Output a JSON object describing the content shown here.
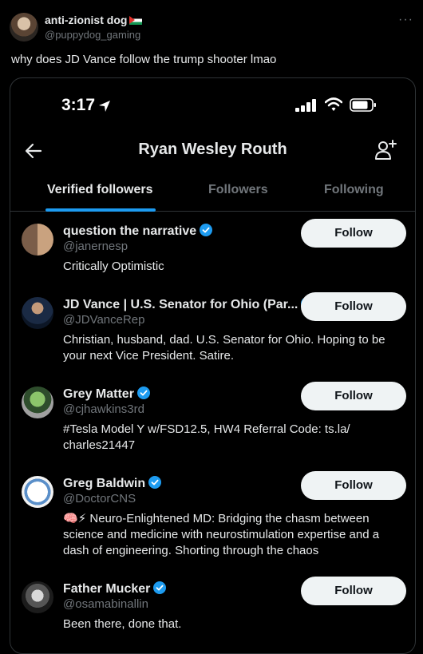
{
  "tweet": {
    "author_name": "anti-zionist dog",
    "author_handle": "@puppydog_gaming",
    "text": "why does JD Vance follow the trump shooter lmao"
  },
  "status_bar": {
    "time": "3:17"
  },
  "profile": {
    "title": "Ryan Wesley Routh"
  },
  "tabs": [
    {
      "label": "Verified followers",
      "active": true
    },
    {
      "label": "Followers",
      "active": false
    },
    {
      "label": "Following",
      "active": false
    }
  ],
  "users": [
    {
      "name": "question the narrative",
      "handle": "@janernesp",
      "bio": "Critically Optimistic",
      "button": "Follow"
    },
    {
      "name": "JD Vance | U.S. Senator for Ohio (Par...",
      "handle": "@JDVanceRep",
      "bio": "Christian, husband, dad. U.S. Senator for Ohio. Hoping to be your next Vice President. Satire.",
      "button": "Follow"
    },
    {
      "name": "Grey Matter",
      "handle": "@cjhawkins3rd",
      "bio": "#Tesla Model Y w/FSD12.5, HW4 Referral Code: ts.la/ charles21447",
      "button": "Follow"
    },
    {
      "name": "Greg Baldwin",
      "handle": "@DoctorCNS",
      "bio": "🧠⚡ Neuro-Enlightened MD: Bridging the chasm between science and medicine with neurostimulation expertise and a dash of engineering. Shorting through the chaos",
      "button": "Follow"
    },
    {
      "name": "Father Mucker",
      "handle": "@osamabinallin",
      "bio": "Been there, done that.",
      "button": "Follow"
    }
  ],
  "colors": {
    "accent": "#1d9bf0",
    "background": "#000000",
    "muted": "#71767b",
    "button_bg": "#eff3f4"
  }
}
